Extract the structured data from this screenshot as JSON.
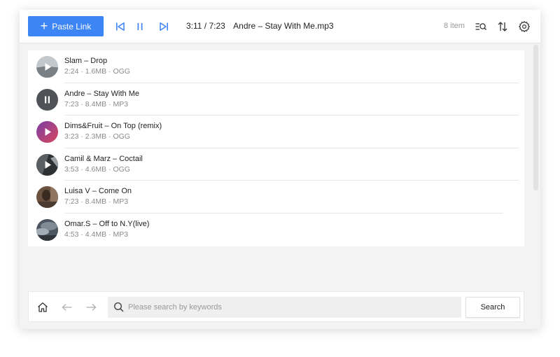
{
  "toolbar": {
    "paste_label": "Paste Link",
    "time": "3:11 / 7:23",
    "current_track": "Andre – Stay With Me.mp3",
    "item_count": "8 item"
  },
  "tracks": [
    {
      "title": "Slam – Drop",
      "meta": "2:24 · 1.6MB · OGG",
      "state": "play",
      "art": "grey-landscape"
    },
    {
      "title": "Andre – Stay With Me",
      "meta": "7:23 · 8.4MB · MP3",
      "state": "pause",
      "art": "dark-grey"
    },
    {
      "title": "Dims&Fruit – On Top (remix)",
      "meta": "3:23 · 2.3MB · OGG",
      "state": "play",
      "art": "purple-red-gradient"
    },
    {
      "title": "Camil & Marz – Coctail",
      "meta": "3:53 · 4.6MB · OGG",
      "state": "play",
      "art": "dark-photo"
    },
    {
      "title": "Luisa V – Come On",
      "meta": "7:23 · 8.4MB · MP3",
      "state": "none",
      "art": "brown-photo"
    },
    {
      "title": "Omar.S – Off to N.Y(live)",
      "meta": "4:53 · 4.4MB · MP3",
      "state": "none",
      "art": "grey-clouds"
    }
  ],
  "search": {
    "placeholder": "Please search by keywords",
    "button_label": "Search"
  },
  "colors": {
    "accent": "#3d84f5",
    "window_bg": "#f3f3f3"
  }
}
